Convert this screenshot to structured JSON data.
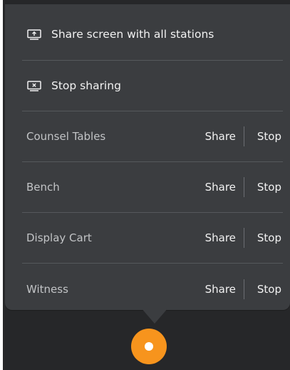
{
  "menu": {
    "share_all": {
      "label": "Share screen with all stations",
      "icon": "screen-share-icon"
    },
    "stop_sharing": {
      "label": "Stop sharing",
      "icon": "screen-stop-icon"
    },
    "stations": [
      {
        "name": "Counsel Tables",
        "share_label": "Share",
        "stop_label": "Stop"
      },
      {
        "name": "Bench",
        "share_label": "Share",
        "stop_label": "Stop"
      },
      {
        "name": "Display Cart",
        "share_label": "Share",
        "stop_label": "Stop"
      },
      {
        "name": "Witness",
        "share_label": "Share",
        "stop_label": "Stop"
      }
    ]
  },
  "colors": {
    "panel_bg": "#3b3d40",
    "backdrop": "#262729",
    "accent_orange": "#f7941d",
    "divider": "#55585c",
    "primary_text": "#f2f2f2",
    "secondary_text": "#c2c4c6"
  },
  "fab": {
    "icon": "record-dot-icon"
  }
}
